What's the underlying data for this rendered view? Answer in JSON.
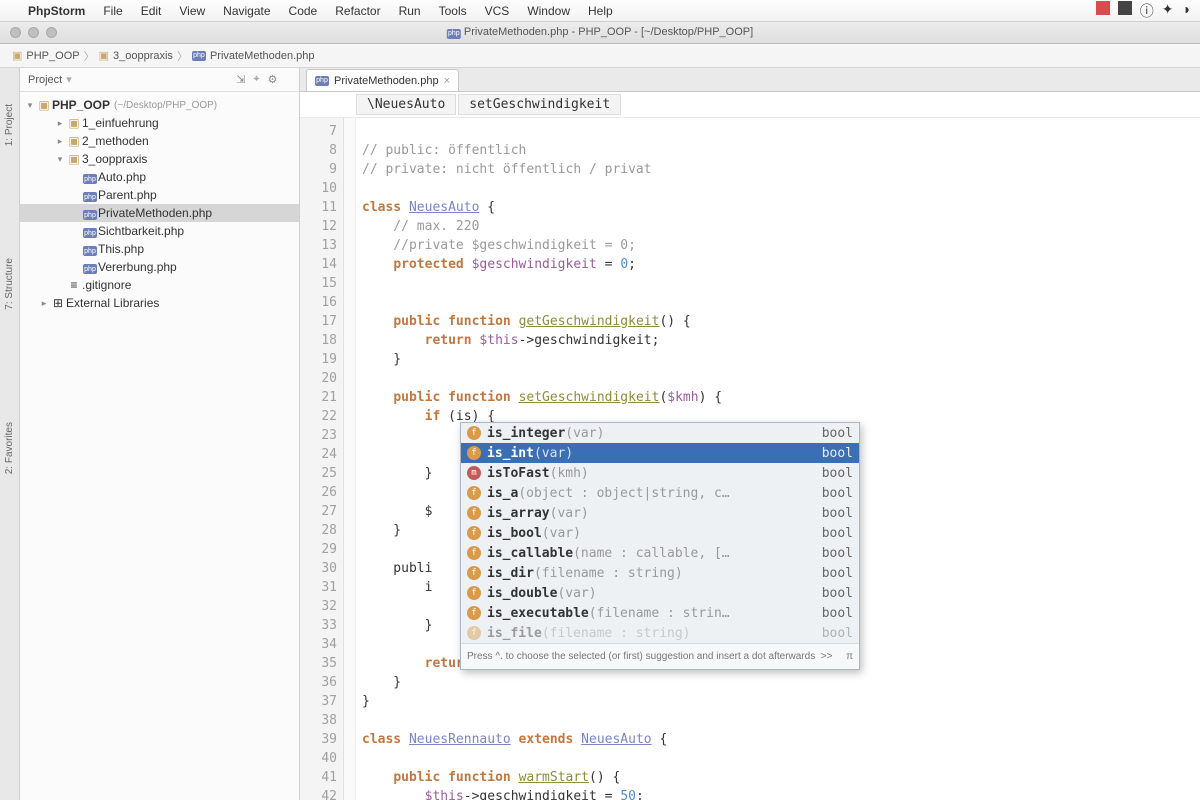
{
  "menubar": {
    "app": "PhpStorm",
    "items": [
      "File",
      "Edit",
      "View",
      "Navigate",
      "Code",
      "Refactor",
      "Run",
      "Tools",
      "VCS",
      "Window",
      "Help"
    ]
  },
  "window_title": "PrivateMethoden.php - PHP_OOP - [~/Desktop/PHP_OOP]",
  "breadcrumb": [
    "PHP_OOP",
    "3_ooppraxis",
    "PrivateMethoden.php"
  ],
  "side_tabs": [
    "1: Project",
    "7: Structure",
    "2: Favorites"
  ],
  "project_panel": {
    "title": "Project",
    "root": {
      "label": "PHP_OOP",
      "hint": "(~/Desktop/PHP_OOP)"
    },
    "tree": [
      {
        "depth": 1,
        "arrow": "▸",
        "icon": "folder",
        "label": "1_einfuehrung"
      },
      {
        "depth": 1,
        "arrow": "▸",
        "icon": "folder",
        "label": "2_methoden"
      },
      {
        "depth": 1,
        "arrow": "▾",
        "icon": "folder",
        "label": "3_ooppraxis"
      },
      {
        "depth": 2,
        "arrow": "",
        "icon": "php",
        "label": "Auto.php"
      },
      {
        "depth": 2,
        "arrow": "",
        "icon": "php",
        "label": "Parent.php"
      },
      {
        "depth": 2,
        "arrow": "",
        "icon": "php",
        "label": "PrivateMethoden.php",
        "selected": true
      },
      {
        "depth": 2,
        "arrow": "",
        "icon": "php",
        "label": "Sichtbarkeit.php"
      },
      {
        "depth": 2,
        "arrow": "",
        "icon": "php",
        "label": "This.php"
      },
      {
        "depth": 2,
        "arrow": "",
        "icon": "php",
        "label": "Vererbung.php"
      },
      {
        "depth": 1,
        "arrow": "",
        "icon": "file",
        "label": ".gitignore"
      },
      {
        "depth": 0,
        "arrow": "▸",
        "icon": "lib",
        "label": "External Libraries"
      }
    ]
  },
  "editor": {
    "tab": "PrivateMethoden.php",
    "crumb": [
      "\\NeuesAuto",
      "setGeschwindigkeit"
    ],
    "first_line": 7,
    "lines": [
      "",
      "// public: öffentlich",
      "// private: nicht öffentlich / privat",
      "",
      "class NeuesAuto {",
      "    // max. 220",
      "    //private $geschwindigkeit = 0;",
      "    protected $geschwindigkeit = 0;",
      "",
      "",
      "    public function getGeschwindigkeit() {",
      "        return $this->geschwindigkeit;",
      "    }",
      "",
      "    public function setGeschwindigkeit($kmh) {",
      "        if (is) {",
      "",
      "",
      "        }",
      "",
      "        $",
      "    }",
      "",
      "    publi",
      "        i",
      "",
      "        }",
      "",
      "        return false;",
      "    }",
      "}",
      "",
      "class NeuesRennauto extends NeuesAuto {",
      "",
      "    public function warmStart() {",
      "        $this->geschwindigkeit = 50;"
    ]
  },
  "autocomplete": {
    "hint": "Press ^. to choose the selected (or first) suggestion and insert a dot afterwards  >>",
    "selected_index": 1,
    "items": [
      {
        "kind": "f",
        "name": "is_integer",
        "params": "(var)",
        "ret": "bool"
      },
      {
        "kind": "f",
        "name": "is_int",
        "params": "(var)",
        "ret": "bool"
      },
      {
        "kind": "m",
        "name": "isToFast",
        "params": "(kmh)",
        "ret": "bool"
      },
      {
        "kind": "f",
        "name": "is_a",
        "params": "(object : object|string, c…",
        "ret": "bool"
      },
      {
        "kind": "f",
        "name": "is_array",
        "params": "(var)",
        "ret": "bool"
      },
      {
        "kind": "f",
        "name": "is_bool",
        "params": "(var)",
        "ret": "bool"
      },
      {
        "kind": "f",
        "name": "is_callable",
        "params": "(name : callable, […",
        "ret": "bool"
      },
      {
        "kind": "f",
        "name": "is_dir",
        "params": "(filename : string)",
        "ret": "bool"
      },
      {
        "kind": "f",
        "name": "is_double",
        "params": "(var)",
        "ret": "bool"
      },
      {
        "kind": "f",
        "name": "is_executable",
        "params": "(filename : strin…",
        "ret": "bool"
      },
      {
        "kind": "f",
        "name": "is_file",
        "params": "(filename : string)",
        "ret": "bool",
        "faded": true
      }
    ]
  }
}
